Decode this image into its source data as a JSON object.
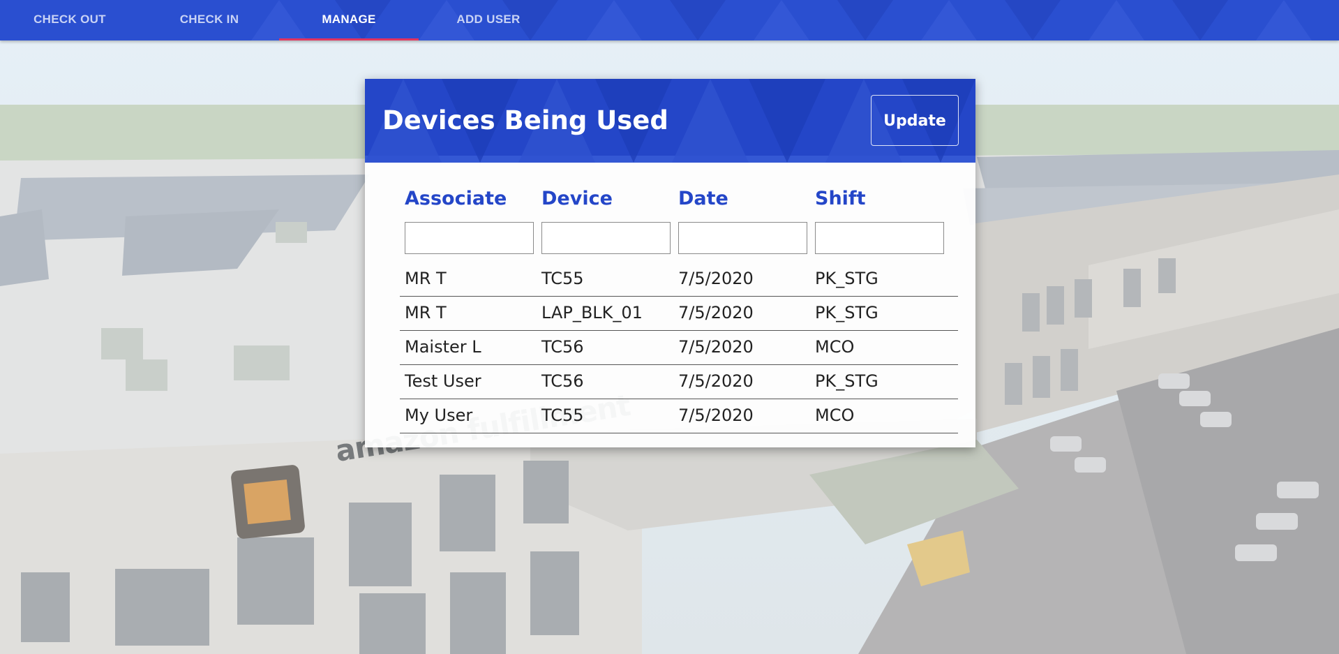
{
  "nav": {
    "tabs": [
      {
        "label": "CHECK OUT",
        "active": false
      },
      {
        "label": "CHECK IN",
        "active": false
      },
      {
        "label": "MANAGE",
        "active": true
      },
      {
        "label": "ADD USER",
        "active": false
      }
    ]
  },
  "card": {
    "title": "Devices Being Used",
    "update_label": "Update",
    "columns": [
      "Associate",
      "Device",
      "Date",
      "Shift"
    ],
    "filters": [
      "",
      "",
      "",
      ""
    ],
    "rows": [
      [
        "MR T",
        "TC55",
        "7/5/2020",
        "PK_STG"
      ],
      [
        "MR T",
        "LAP_BLK_01",
        "7/5/2020",
        "PK_STG"
      ],
      [
        "Maister L",
        "TC56",
        "7/5/2020",
        "MCO"
      ],
      [
        "Test User",
        "TC56",
        "7/5/2020",
        "PK_STG"
      ],
      [
        "My User",
        "TC55",
        "7/5/2020",
        "MCO"
      ]
    ]
  },
  "background": {
    "sign_text": "amazon fulfillment"
  },
  "colors": {
    "nav_bg": "#2a4fd0",
    "accent": "#2446c8",
    "tab_indicator": "#e2345f"
  }
}
